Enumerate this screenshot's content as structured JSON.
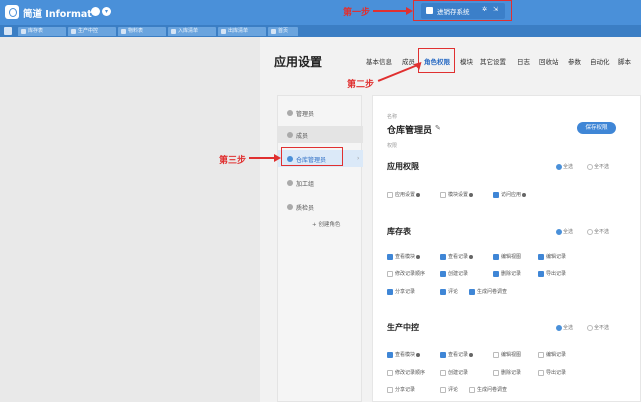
{
  "app": {
    "brand": "简道 Informat",
    "current_app": "进销存系统"
  },
  "tabs": [
    "库存表",
    "生产中控",
    "物料表",
    "入库清单",
    "出库清单",
    "首页"
  ],
  "page": {
    "title": "应用设置"
  },
  "nav": [
    "基本信息",
    "成员",
    "角色权限",
    "模块",
    "其它设置",
    "日志",
    "回收站",
    "参数",
    "自动化",
    "脚本"
  ],
  "roles": [
    "管理员",
    "成员",
    "仓库管理员",
    "加工组",
    "质检员"
  ],
  "add_role": "+ 创建角色",
  "panel": {
    "name_label": "名称",
    "role_name": "仓库管理员",
    "perm_label": "权限",
    "save": "保存权限",
    "sections": [
      {
        "title": "应用权限",
        "select_all": "全选",
        "select_none": "全不选",
        "items": [
          {
            "label": "应用设置",
            "checked": false,
            "info": true
          },
          {
            "label": "模块设置",
            "checked": false,
            "info": true
          },
          {
            "label": "访问应用",
            "checked": true,
            "info": true
          }
        ]
      },
      {
        "title": "库存表",
        "select_all": "全选",
        "select_none": "全不选",
        "items": [
          {
            "label": "查看模块",
            "checked": true,
            "info": true
          },
          {
            "label": "查看记录",
            "checked": true,
            "info": true
          },
          {
            "label": "编辑视图",
            "checked": true
          },
          {
            "label": "编辑记录",
            "checked": true
          },
          {
            "label": "修改记录顺序",
            "checked": false
          },
          {
            "label": "创建记录",
            "checked": true
          },
          {
            "label": "删除记录",
            "checked": true
          },
          {
            "label": "导出记录",
            "checked": true
          },
          {
            "label": "分享记录",
            "checked": true
          },
          {
            "label": "评论",
            "checked": true
          },
          {
            "label": "生成问卷调查",
            "checked": true
          }
        ]
      },
      {
        "title": "生产中控",
        "select_all": "全选",
        "select_none": "全不选",
        "items": [
          {
            "label": "查看模块",
            "checked": true,
            "info": true
          },
          {
            "label": "查看记录",
            "checked": true,
            "info": true
          },
          {
            "label": "编辑视图",
            "checked": false
          },
          {
            "label": "编辑记录",
            "checked": false
          },
          {
            "label": "修改记录顺序",
            "checked": false
          },
          {
            "label": "创建记录",
            "checked": false
          },
          {
            "label": "删除记录",
            "checked": false
          },
          {
            "label": "导出记录",
            "checked": false
          },
          {
            "label": "分享记录",
            "checked": false
          },
          {
            "label": "评论",
            "checked": false
          },
          {
            "label": "生成问卷调查",
            "checked": false
          }
        ]
      }
    ]
  },
  "annotations": [
    "第一步",
    "第二步",
    "第三步"
  ],
  "colors": {
    "topbar": "#4a90d9",
    "accent": "#3f86d6",
    "annotation": "#e03030"
  }
}
